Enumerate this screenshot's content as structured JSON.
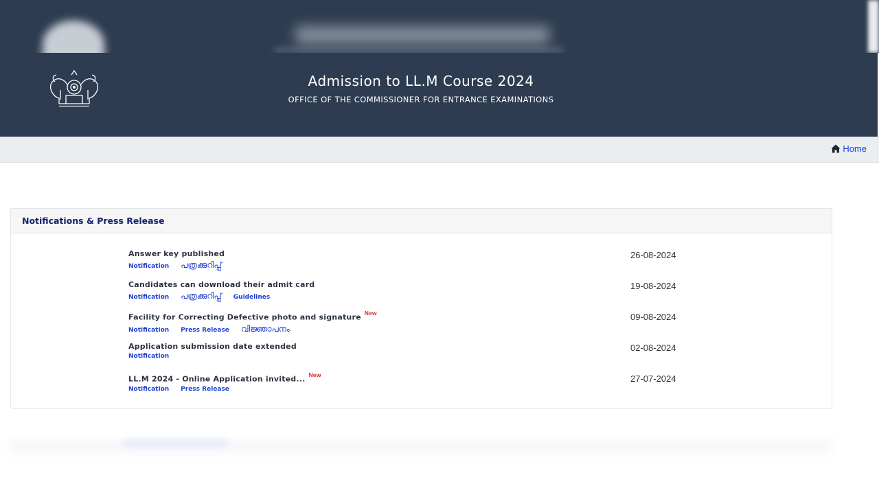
{
  "header": {
    "title": "Admission to LL.M Course 2024",
    "subtitle": "OFFICE OF THE COMMISSIONER FOR ENTRANCE EXAMINATIONS",
    "emblem_icon": "government-of-kerala-emblem"
  },
  "nav": {
    "home_label": "Home",
    "home_icon": "home-icon"
  },
  "panel": {
    "title": "Notifications & Press Release",
    "items": [
      {
        "title": "Answer key published",
        "new": "",
        "date": "26-08-2024",
        "links": [
          "Notification",
          "പത്രക്കുറിപ്പ്"
        ]
      },
      {
        "title": "Candidates can download their admit card",
        "new": "",
        "date": "19-08-2024",
        "links": [
          "Notification",
          "പത്രക്കുറിപ്പ്",
          "Guidelines"
        ]
      },
      {
        "title": "Facility for Correcting Defective photo and signature",
        "new": "New",
        "date": "09-08-2024",
        "links": [
          "Notification",
          "Press Release",
          "വിജ്ഞാപനം"
        ]
      },
      {
        "title": "Application submission date extended",
        "new": "",
        "date": "02-08-2024",
        "links": [
          "Notification"
        ]
      },
      {
        "title": "LL.M 2024 - Online Application invited...",
        "new": "New",
        "date": "27-07-2024",
        "links": [
          "Notification",
          "Press Release"
        ]
      }
    ]
  },
  "colors": {
    "header_bg": "#2d3c50",
    "link": "#1d3fd1",
    "new_tag": "#e02424",
    "panel_title": "#13226a"
  }
}
